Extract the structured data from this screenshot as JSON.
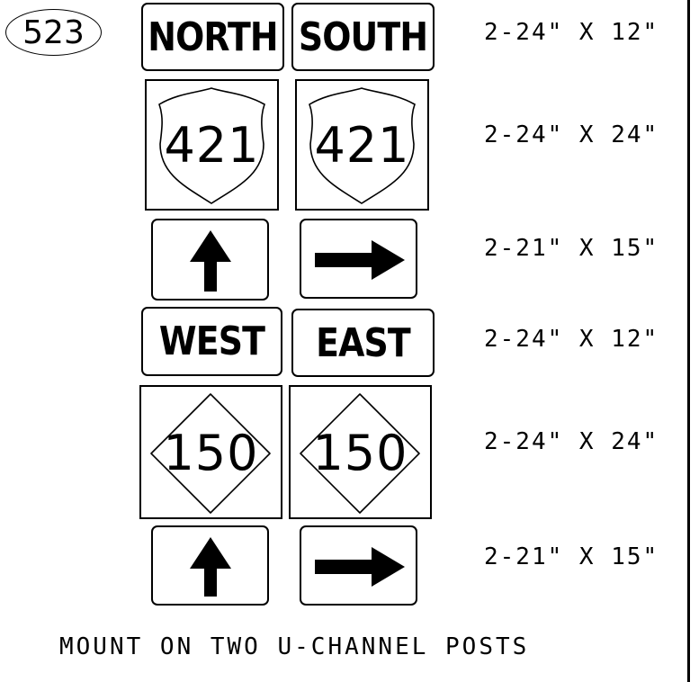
{
  "assembly_number": "523",
  "rows": [
    {
      "signs": [
        {
          "type": "word",
          "text": "NORTH"
        },
        {
          "type": "word",
          "text": "SOUTH"
        }
      ],
      "dimensions": "2-24\" X 12\""
    },
    {
      "signs": [
        {
          "type": "us-route-shield",
          "text": "421"
        },
        {
          "type": "us-route-shield",
          "text": "421"
        }
      ],
      "dimensions": "2-24\" X 24\""
    },
    {
      "signs": [
        {
          "type": "arrow",
          "icon": "arrow-up-icon"
        },
        {
          "type": "arrow",
          "icon": "arrow-right-icon"
        }
      ],
      "dimensions": "2-21\" X 15\""
    },
    {
      "signs": [
        {
          "type": "word",
          "text": "WEST"
        },
        {
          "type": "word",
          "text": "EAST"
        }
      ],
      "dimensions": "2-24\" X 12\""
    },
    {
      "signs": [
        {
          "type": "state-route-diamond",
          "text": "150"
        },
        {
          "type": "state-route-diamond",
          "text": "150"
        }
      ],
      "dimensions": "2-24\" X 24\""
    },
    {
      "signs": [
        {
          "type": "arrow",
          "icon": "arrow-up-icon"
        },
        {
          "type": "arrow",
          "icon": "arrow-right-icon"
        }
      ],
      "dimensions": "2-21\" X 15\""
    }
  ],
  "note": "MOUNT ON TWO U-CHANNEL POSTS"
}
